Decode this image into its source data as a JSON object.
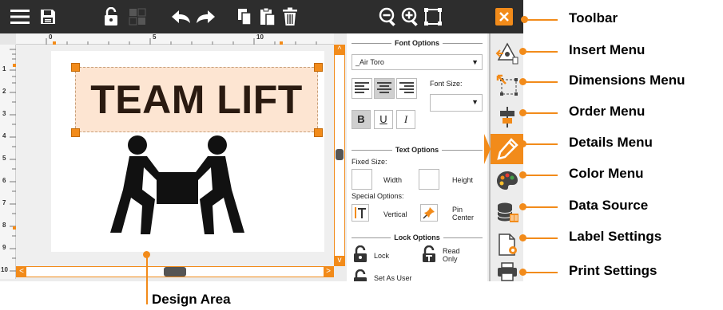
{
  "colors": {
    "accent": "#f28b1a",
    "toolbar": "#2d2d2d",
    "text_box_fill": "#fde5d2"
  },
  "toolbar": {
    "icons": [
      "menu-icon",
      "save-icon",
      "unlock-icon",
      "grid-icon",
      "undo-icon",
      "redo-icon",
      "copy-icon",
      "paste-icon",
      "trash-icon",
      "zoom-out-icon",
      "zoom-in-icon",
      "fit-icon",
      "close-icon"
    ]
  },
  "rulers": {
    "top_numbers": [
      "0",
      "5",
      "10"
    ],
    "left_numbers": [
      "1",
      "2",
      "3",
      "4",
      "5",
      "6",
      "7",
      "8",
      "9",
      "10"
    ]
  },
  "canvas": {
    "text": "TEAM LIFT",
    "image": "two-people-lifting-box"
  },
  "options": {
    "font_section": "Font Options",
    "font_name": "_Air Toro",
    "font_size_label": "Font Size:",
    "font_size_value": "",
    "bold": "B",
    "underline": "U",
    "italic": "I",
    "text_section": "Text Options",
    "fixed_size": "Fixed Size:",
    "width": "Width",
    "height": "Height",
    "special_options": "Special Options:",
    "vertical": "Vertical",
    "pin_center_1": "Pin",
    "pin_center_2": "Center",
    "lock_section": "Lock Options",
    "lock": "Lock",
    "read_only_1": "Read",
    "read_only_2": "Only",
    "set_as_user": "Set As User"
  },
  "side_menu": [
    {
      "name": "insert",
      "icon": "insert-icon"
    },
    {
      "name": "dimensions",
      "icon": "dimensions-icon"
    },
    {
      "name": "order",
      "icon": "order-icon"
    },
    {
      "name": "details",
      "icon": "pencil-icon",
      "active": true
    },
    {
      "name": "color",
      "icon": "palette-icon"
    },
    {
      "name": "data-source",
      "icon": "database-icon"
    },
    {
      "name": "label-settings",
      "icon": "label-settings-icon"
    },
    {
      "name": "print-settings",
      "icon": "printer-icon"
    }
  ],
  "callouts": {
    "toolbar": "Toolbar",
    "insert": "Insert Menu",
    "dimensions": "Dimensions Menu",
    "order": "Order Menu",
    "details": "Details Menu",
    "color": "Color Menu",
    "data_source": "Data Source",
    "label_settings": "Label Settings",
    "print_settings": "Print Settings",
    "design_area": "Design Area"
  }
}
